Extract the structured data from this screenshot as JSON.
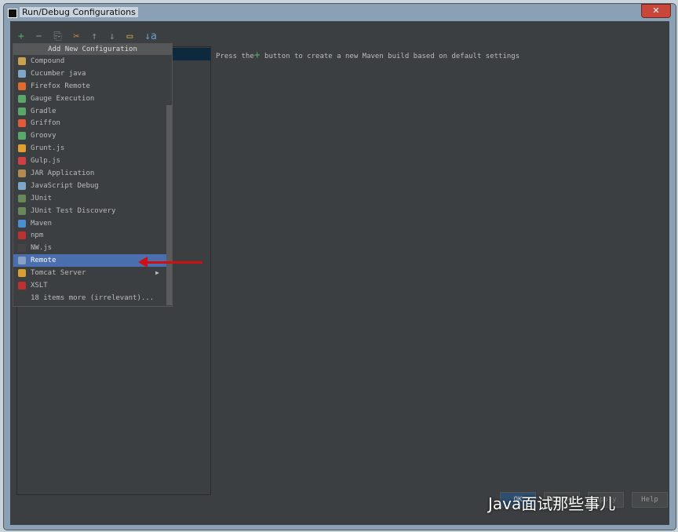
{
  "window": {
    "title": "Run/Debug Configurations",
    "close_label": "✕"
  },
  "toolbar": [
    "+",
    "−",
    "⎘",
    "✂",
    "↑",
    "↓",
    "▭",
    "↓a"
  ],
  "message": {
    "before": "Press the",
    "plus": "+",
    "after": " button to create a new Maven build based on default settings"
  },
  "popup": {
    "header": "Add New Configuration",
    "items": [
      {
        "label": "Compound",
        "color": "#c8a24a"
      },
      {
        "label": "Cucumber java",
        "color": "#7fa6c8"
      },
      {
        "label": "Firefox Remote",
        "color": "#e06b2c"
      },
      {
        "label": "Gauge Execution",
        "color": "#59a869"
      },
      {
        "label": "Gradle",
        "color": "#59a869"
      },
      {
        "label": "Griffon",
        "color": "#e05a3c"
      },
      {
        "label": "Groovy",
        "color": "#59a869"
      },
      {
        "label": "Grunt.js",
        "color": "#e0a030"
      },
      {
        "label": "Gulp.js",
        "color": "#d04040"
      },
      {
        "label": "JAR Application",
        "color": "#b08a50"
      },
      {
        "label": "JavaScript Debug",
        "color": "#7fa6c8"
      },
      {
        "label": "JUnit",
        "color": "#6a8759"
      },
      {
        "label": "JUnit Test Discovery",
        "color": "#6a8759"
      },
      {
        "label": "Maven",
        "color": "#4a8fd0"
      },
      {
        "label": "npm",
        "color": "#c03030"
      },
      {
        "label": "NW.js",
        "color": "#444"
      },
      {
        "label": "Remote",
        "color": "#8aa0c0",
        "active": true
      },
      {
        "label": "Tomcat Server",
        "color": "#d8a030",
        "submenu": true
      },
      {
        "label": "XSLT",
        "color": "#c03030"
      },
      {
        "label": "18 items more (irrelevant)...",
        "color": ""
      }
    ]
  },
  "buttons": {
    "ok": "OK",
    "close": "Close",
    "apply": "Apply",
    "help": "Help"
  },
  "watermark": "Java面试那些事儿"
}
